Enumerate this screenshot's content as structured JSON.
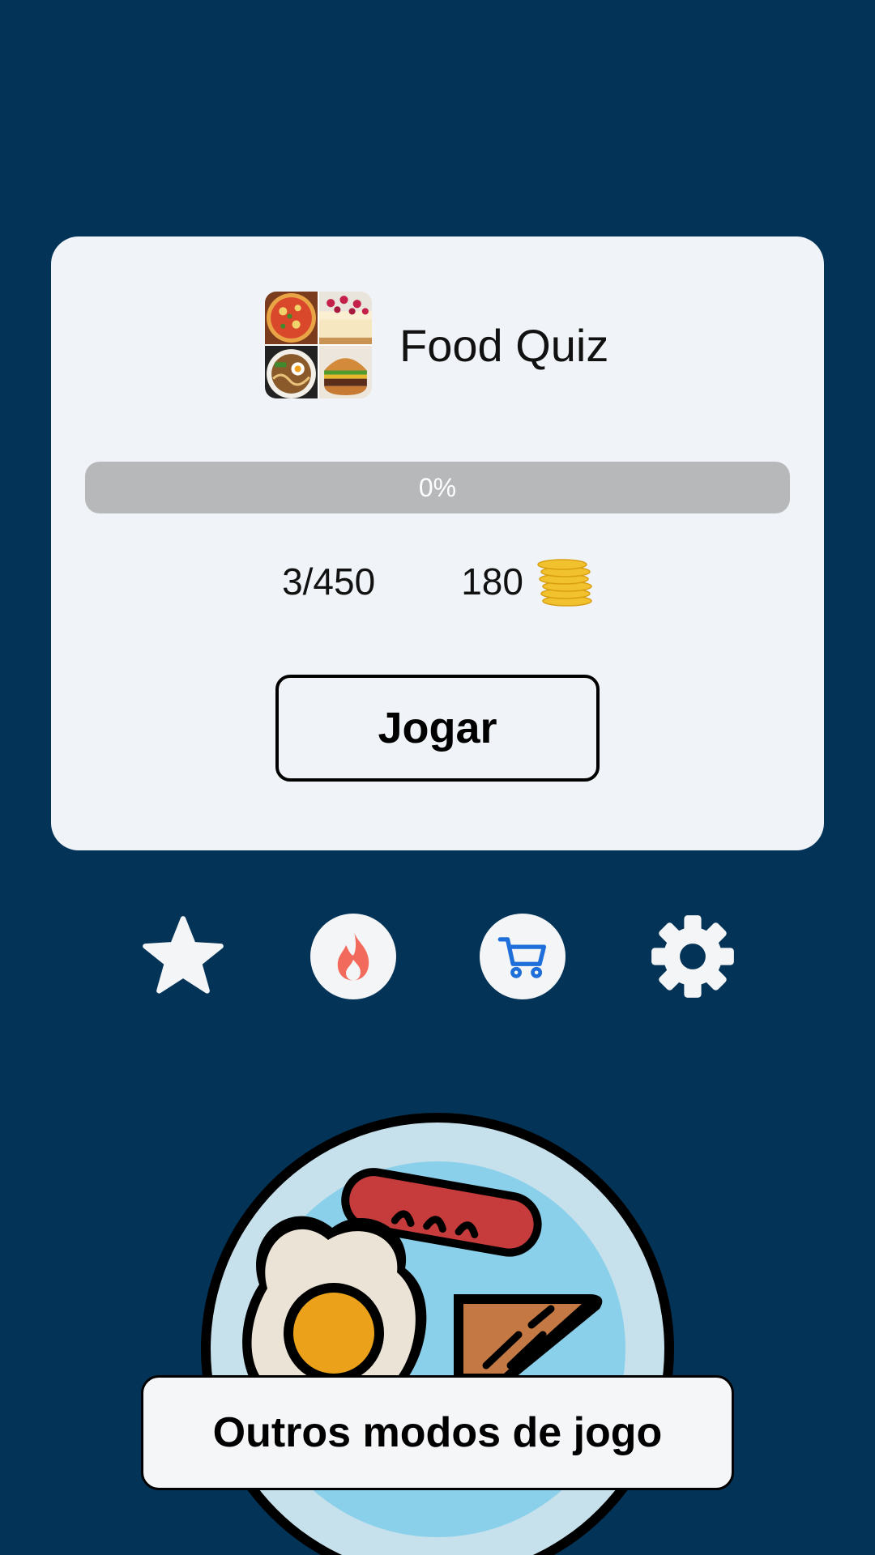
{
  "quiz": {
    "title": "Food Quiz",
    "progress_label": "0%",
    "progress_value": 0,
    "level_count": "3/450",
    "coins": "180",
    "play_label": "Jogar"
  },
  "toolbar": {
    "icons": [
      "star-icon",
      "fire-icon",
      "cart-icon",
      "gear-icon"
    ]
  },
  "modes_label": "Outros modos de jogo",
  "colors": {
    "background": "#033356",
    "card": "#f0f3f7",
    "progress_track": "#b7b8ba",
    "fire": "#f26a5c",
    "cart": "#1e6fd9",
    "coin": "#f2c12e"
  }
}
